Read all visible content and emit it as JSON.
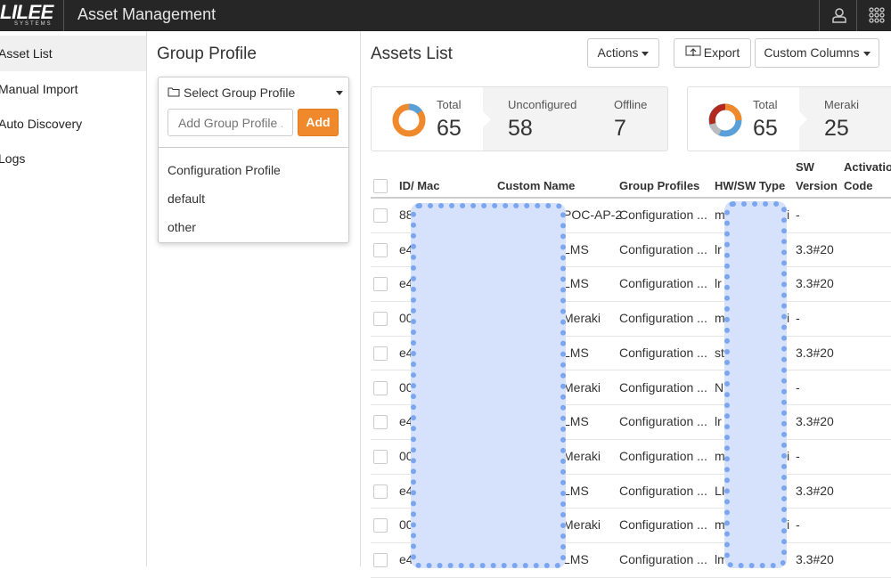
{
  "header": {
    "logo_main": "LILEE",
    "logo_sub": "SYSTEMS",
    "app_title": "Asset Management",
    "icons": [
      "user-icon",
      "apps-grid-icon"
    ]
  },
  "sidebar": {
    "items": [
      {
        "label": "Asset List",
        "active": true
      },
      {
        "label": "Manual Import"
      },
      {
        "label": "Auto Discovery"
      },
      {
        "label": "Logs"
      }
    ]
  },
  "group_profile": {
    "title": "Group Profile",
    "select_label": "Select Group Profile",
    "input_placeholder": "Add Group Profile ...",
    "add_label": "Add",
    "options": [
      "Configuration Profile",
      "default",
      "other"
    ]
  },
  "assets": {
    "title": "Assets List",
    "actions_label": "Actions",
    "export_label": "Export",
    "custom_columns_label": "Custom Columns",
    "card1": {
      "total_label": "Total",
      "total_value": "65",
      "unconfigured_label": "Unconfigured",
      "unconfigured_value": "58",
      "offline_label": "Offline",
      "offline_value": "7"
    },
    "card2": {
      "total_label": "Total",
      "total_value": "65",
      "meraki_label": "Meraki",
      "meraki_value": "25"
    },
    "columns": {
      "id_mac": "ID/ Mac",
      "custom_name": "Custom Name",
      "group_profiles": "Group Profiles",
      "hw_sw_type": "HW/SW Type",
      "sw_version_1": "SW",
      "sw_version_2": "Version",
      "activation_1": "Activation",
      "activation_2": "Code"
    },
    "rows": [
      {
        "id": "88",
        "name": "POC-AP-2",
        "group": "Configuration ...",
        "hw": "m",
        "hw_tail": "ki",
        "sw": "-"
      },
      {
        "id": "e4",
        "name": "LMS",
        "group": "Configuration ...",
        "hw": "lr",
        "hw_tail": "",
        "sw": "3.3#20"
      },
      {
        "id": "e4",
        "name": "LMS",
        "group": "Configuration ...",
        "hw": "lr",
        "hw_tail": "",
        "sw": "3.3#20"
      },
      {
        "id": "00",
        "name": "Meraki",
        "group": "Configuration ...",
        "hw": "m",
        "hw_tail": "ki",
        "sw": "-"
      },
      {
        "id": "e4",
        "name": "LMS",
        "group": "Configuration ...",
        "hw": "st",
        "hw_tail": "",
        "sw": "3.3#20"
      },
      {
        "id": "00",
        "name": "Meraki",
        "group": "Configuration ...",
        "hw": "N",
        "hw_tail": "",
        "sw": "-"
      },
      {
        "id": "e4",
        "name": "LMS",
        "group": "Configuration ...",
        "hw": "lr",
        "hw_tail": "",
        "sw": "3.3#20"
      },
      {
        "id": "00",
        "name": "Meraki",
        "group": "Configuration ...",
        "hw": "m",
        "hw_tail": "ki",
        "sw": "-"
      },
      {
        "id": "e4",
        "name": "LMS",
        "group": "Configuration ...",
        "hw": "LI",
        "hw_tail": "",
        "sw": "3.3#20"
      },
      {
        "id": "00",
        "name": "Meraki",
        "group": "Configuration ...",
        "hw": "m",
        "hw_tail": "ki",
        "sw": "-"
      },
      {
        "id": "e4",
        "name": "LMS",
        "group": "Configuration ...",
        "hw": "lm",
        "hw_tail": "",
        "sw": "3.3#20"
      }
    ]
  },
  "colors": {
    "accent": "#f0892b",
    "topbar": "#262626",
    "donut_blue": "#5aa0d8",
    "donut_red": "#b22a1f",
    "redaction_fill": "#d6e2fb",
    "redaction_border": "#7aa5f0"
  }
}
